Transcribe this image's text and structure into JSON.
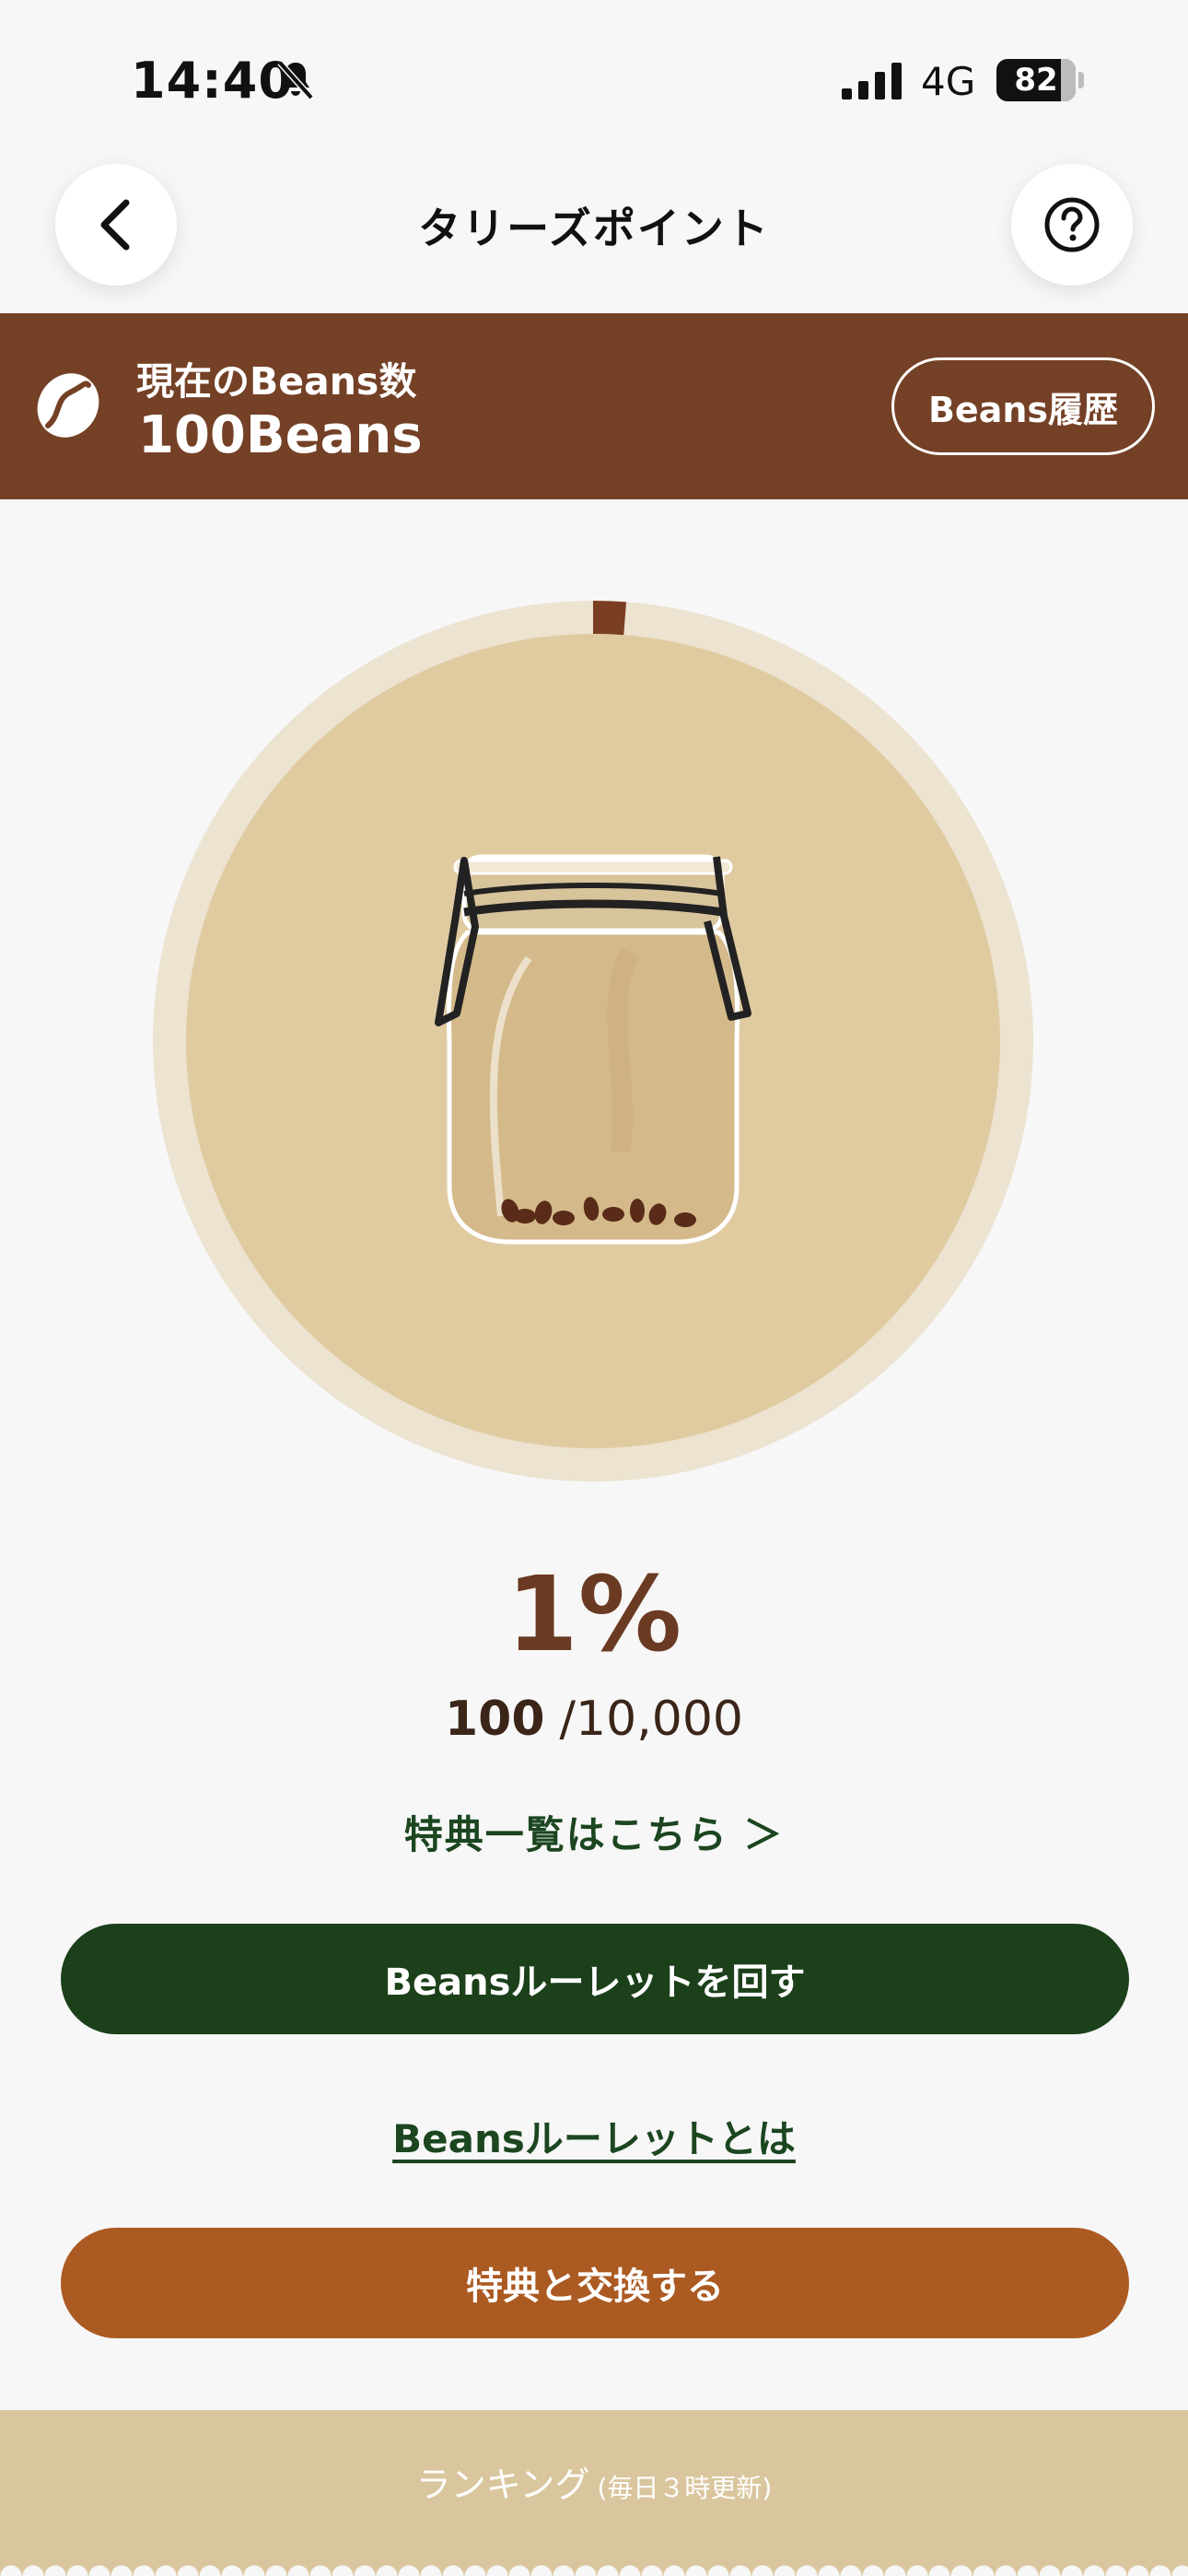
{
  "status_bar": {
    "time": "14:40",
    "network": "4G",
    "battery": "82"
  },
  "header": {
    "title": "タリーズポイント"
  },
  "beans_summary": {
    "label": "現在のBeans数",
    "value": "100Beans",
    "history_button": "Beans履歴"
  },
  "progress": {
    "fraction": 0.01,
    "percent_text": "1%",
    "current": "100",
    "total": "/10,000",
    "track_color": "#ece3d1",
    "fill_color": "#7a3f23",
    "inner_color": "#e0cba1"
  },
  "links": {
    "benefits": "特典一覧はこちら ＞",
    "roulette_about": "Beansルーレットとは"
  },
  "buttons": {
    "roulette": "Beansルーレットを回す",
    "exchange": "特典と交換する"
  },
  "ranking": {
    "label": "ランキング",
    "note": "(毎日３時更新)"
  },
  "colors": {
    "brown": "#744126",
    "green": "#1b401a",
    "orange": "#ab5a22",
    "ranking_bg": "#dac69e"
  }
}
